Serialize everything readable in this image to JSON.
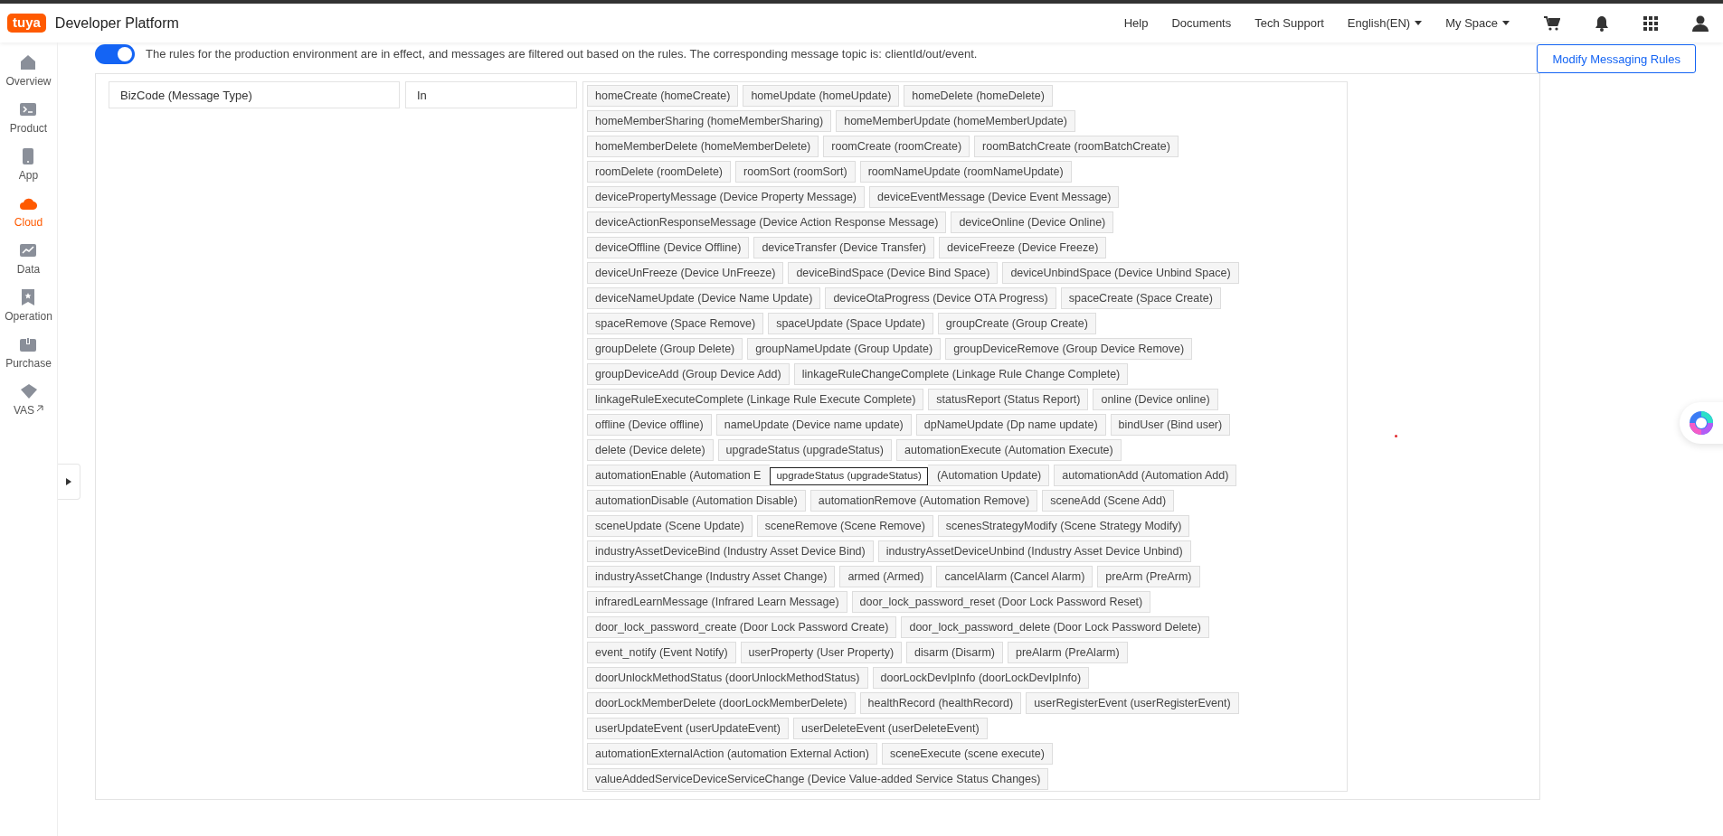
{
  "header": {
    "logo": "tuya",
    "title": "Developer Platform",
    "nav": [
      {
        "label": "Help",
        "kind": "link"
      },
      {
        "label": "Documents",
        "kind": "link"
      },
      {
        "label": "Tech Support",
        "kind": "link"
      },
      {
        "label": "English(EN)",
        "kind": "dropdown"
      },
      {
        "label": "My Space",
        "kind": "dropdown"
      }
    ]
  },
  "sidebar": {
    "items": [
      {
        "label": "Overview",
        "selected": false
      },
      {
        "label": "Product",
        "selected": false
      },
      {
        "label": "App",
        "selected": false
      },
      {
        "label": "Cloud",
        "selected": true
      },
      {
        "label": "Data",
        "selected": false
      },
      {
        "label": "Operation",
        "selected": false
      },
      {
        "label": "Purchase",
        "selected": false
      },
      {
        "label": "VAS",
        "selected": false
      }
    ]
  },
  "rules": {
    "enabled": true,
    "notice": "The rules for the production environment are in effect, and messages are filtered out based on the rules. The corresponding message topic is: clientId/out/event.",
    "button": "Modify Messaging Rules"
  },
  "filter": {
    "field": "BizCode (Message Type)",
    "operator": "In",
    "tag_rows": [
      {
        "covered": false,
        "tags": [
          "homeCreate (homeCreate)",
          "homeUpdate (homeUpdate)",
          "homeDelete (homeDelete)"
        ]
      },
      {
        "covered": false,
        "tags": [
          "homeMemberSharing (homeMemberSharing)",
          "homeMemberUpdate (homeMemberUpdate)"
        ]
      },
      {
        "covered": false,
        "tags": [
          "homeMemberDelete (homeMemberDelete)",
          "roomCreate (roomCreate)",
          "roomBatchCreate (roomBatchCreate)"
        ]
      },
      {
        "covered": false,
        "tags": [
          "roomDelete (roomDelete)",
          "roomSort (roomSort)",
          "roomNameUpdate (roomNameUpdate)"
        ]
      },
      {
        "covered": false,
        "tags": [
          "devicePropertyMessage (Device Property Message)",
          "deviceEventMessage (Device Event Message)"
        ]
      },
      {
        "covered": false,
        "tags": [
          "deviceActionResponseMessage (Device Action Response Message)",
          "deviceOnline (Device Online)"
        ]
      },
      {
        "covered": false,
        "tags": [
          "deviceOffline (Device Offline)",
          "deviceTransfer (Device Transfer)",
          "deviceFreeze (Device Freeze)"
        ]
      },
      {
        "covered": false,
        "tags": [
          "deviceUnFreeze (Device UnFreeze)",
          "deviceBindSpace (Device Bind Space)",
          "deviceUnbindSpace (Device Unbind Space)"
        ]
      },
      {
        "covered": false,
        "tags": [
          "deviceNameUpdate (Device Name Update)",
          "deviceOtaProgress (Device OTA Progress)",
          "spaceCreate (Space Create)"
        ]
      },
      {
        "covered": false,
        "tags": [
          "spaceRemove (Space Remove)",
          "spaceUpdate (Space Update)",
          "groupCreate (Group Create)"
        ]
      },
      {
        "covered": false,
        "tags": [
          "groupDelete (Group Delete)",
          "groupNameUpdate (Group Update)",
          "groupDeviceRemove (Group Device Remove)"
        ]
      },
      {
        "covered": false,
        "tags": [
          "groupDeviceAdd (Group Device Add)",
          "linkageRuleChangeComplete (Linkage Rule Change Complete)"
        ]
      },
      {
        "covered": false,
        "tags": [
          "linkageRuleExecuteComplete (Linkage Rule Execute Complete)",
          "statusReport (Status Report)",
          "online (Device online)"
        ]
      },
      {
        "covered": false,
        "tags": [
          "offline (Device offline)",
          "nameUpdate (Device name update)",
          "dpNameUpdate (Dp name update)",
          "bindUser (Bind user)"
        ]
      },
      {
        "covered": false,
        "tags": [
          "delete (Device delete)",
          "upgradeStatus (upgradeStatus)",
          "automationExecute (Automation Execute)"
        ]
      },
      {
        "covered": true,
        "tags": [
          "automationEnable (Automation E",
          "(Automation Update)",
          "automationAdd (Automation Add)"
        ]
      },
      {
        "covered": false,
        "tags": [
          "automationDisable (Automation Disable)",
          "automationRemove (Automation Remove)",
          "sceneAdd (Scene Add)"
        ]
      },
      {
        "covered": false,
        "tags": [
          "sceneUpdate (Scene Update)",
          "sceneRemove (Scene Remove)",
          "scenesStrategyModify (Scene Strategy Modify)"
        ]
      },
      {
        "covered": false,
        "tags": [
          "industryAssetDeviceBind (Industry Asset Device Bind)",
          "industryAssetDeviceUnbind (Industry Asset Device Unbind)"
        ]
      },
      {
        "covered": false,
        "tags": [
          "industryAssetChange (Industry Asset Change)",
          "armed (Armed)",
          "cancelAlarm (Cancel Alarm)",
          "preArm (PreArm)"
        ]
      },
      {
        "covered": false,
        "tags": [
          "infraredLearnMessage (Infrared Learn Message)",
          "door_lock_password_reset (Door Lock Password Reset)"
        ]
      },
      {
        "covered": false,
        "tags": [
          "door_lock_password_create (Door Lock Password Create)",
          "door_lock_password_delete (Door Lock Password Delete)"
        ]
      },
      {
        "covered": false,
        "tags": [
          "event_notify (Event Notify)",
          "userProperty (User Property)",
          "disarm (Disarm)",
          "preAlarm (PreAlarm)"
        ]
      },
      {
        "covered": false,
        "tags": [
          "doorUnlockMethodStatus (doorUnlockMethodStatus)",
          "doorLockDevIpInfo (doorLockDevIpInfo)"
        ]
      },
      {
        "covered": false,
        "tags": [
          "doorLockMemberDelete (doorLockMemberDelete)",
          "healthRecord (healthRecord)",
          "userRegisterEvent (userRegisterEvent)"
        ]
      },
      {
        "covered": false,
        "tags": [
          "userUpdateEvent (userUpdateEvent)",
          "userDeleteEvent (userDeleteEvent)"
        ]
      },
      {
        "covered": false,
        "tags": [
          "automationExternalAction (automation External Action)",
          "sceneExecute (scene execute)"
        ]
      },
      {
        "covered": false,
        "tags": [
          "valueAddedServiceDeviceServiceChange (Device Value-added Service Status Changes)"
        ]
      }
    ],
    "tooltip": "upgradeStatus (upgradeStatus)"
  }
}
